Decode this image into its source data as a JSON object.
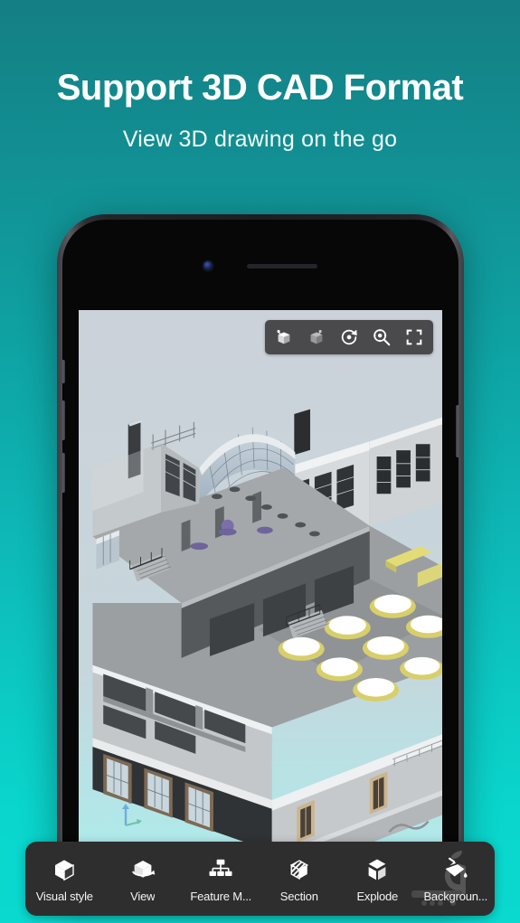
{
  "hero": {
    "title": "Support 3D CAD Format",
    "subtitle": "View 3D drawing on the go"
  },
  "colors": {
    "bg_top": "#147f84",
    "bg_bottom": "#0ad9cf",
    "toolbar_bg": "#2e2e2e",
    "view_toolbar_bg": "#4a4a4c",
    "label_text": "#f4f4f4",
    "screen_top": "#ccd2d9",
    "screen_bottom": "#a5f2f0"
  },
  "device": {
    "type": "smartphone",
    "frame_color": "#2e2e33",
    "camera": "front-camera",
    "speaker": "earpiece-speaker"
  },
  "viewer_toolbar": {
    "buttons": [
      {
        "name": "orbit-tool",
        "icon": "cube-orbit-icon",
        "active": true
      },
      {
        "name": "pan-tool",
        "icon": "cube-pan-icon",
        "active": false
      },
      {
        "name": "rotate-tool",
        "icon": "rotate-refresh-icon",
        "active": false
      },
      {
        "name": "zoom-tool",
        "icon": "magnifier-target-icon",
        "active": false
      },
      {
        "name": "fullscreen-tool",
        "icon": "expand-fullscreen-icon",
        "active": false
      }
    ]
  },
  "app_toolbar": {
    "items": [
      {
        "label": "Visual style",
        "icon": "cube-outline-icon"
      },
      {
        "label": "View",
        "icon": "cube-rotate-icon"
      },
      {
        "label": "Feature M...",
        "icon": "hierarchy-tree-icon"
      },
      {
        "label": "Section",
        "icon": "cube-hatched-icon"
      },
      {
        "label": "Explode",
        "icon": "cube-exploded-icon"
      },
      {
        "label": "Backgroun...",
        "icon": "paint-bucket-icon"
      }
    ]
  },
  "watermark": {
    "name": "sibche-logo-watermark",
    "glyph": "apple-mark"
  },
  "model": {
    "name": "architectural-building-model",
    "description": "Isometric cutaway of a multi-room building with curved glass atrium, banquet tables, staircases and window walls",
    "ucs_axis_label": "Z"
  }
}
